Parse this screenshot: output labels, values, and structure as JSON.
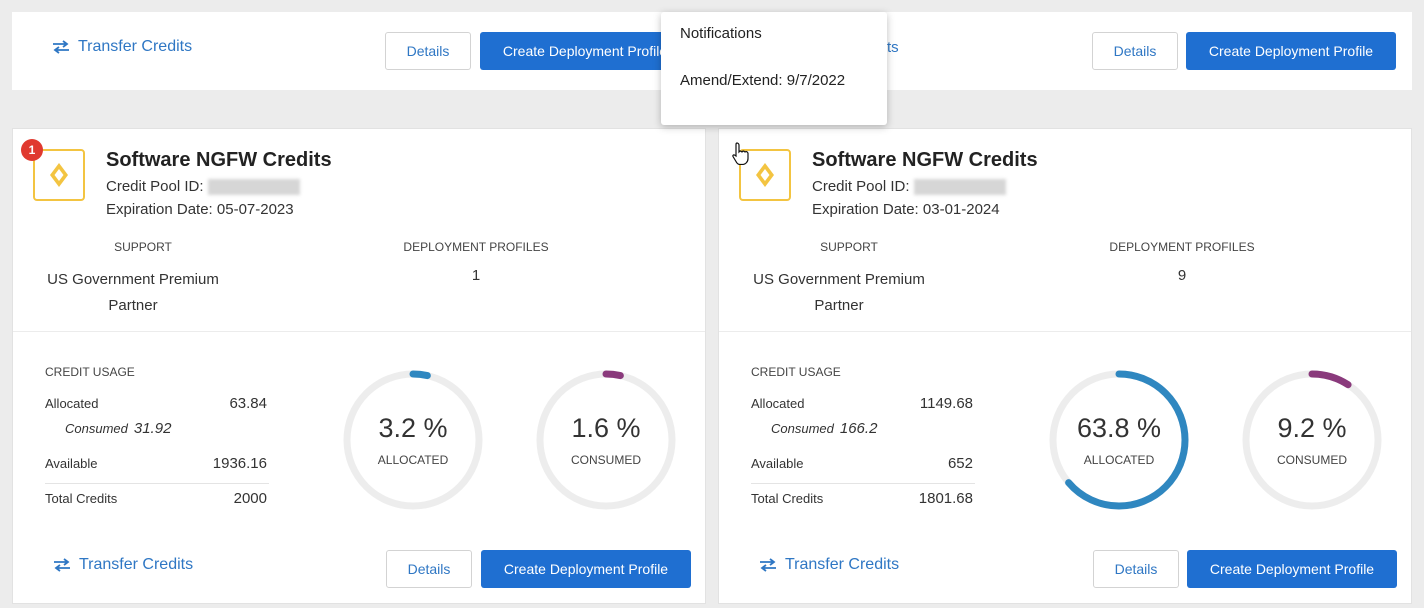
{
  "top_cards": {
    "transfer_label": "Transfer Credits",
    "details_label": "Details",
    "create_label": "Create Deployment Profile",
    "right_fragment": "ts"
  },
  "notifications": {
    "title": "Notifications",
    "item": "Amend/Extend: 9/7/2022"
  },
  "labels": {
    "credit_pool_id": "Credit Pool ID:",
    "support": "SUPPORT",
    "deployment_profiles": "DEPLOYMENT PROFILES",
    "credit_usage": "CREDIT USAGE",
    "allocated": "Allocated",
    "consumed": "Consumed",
    "available": "Available",
    "total_credits": "Total Credits",
    "gauge_allocated": "ALLOCATED",
    "gauge_consumed": "CONSUMED",
    "transfer": "Transfer Credits",
    "details": "Details",
    "create": "Create Deployment Profile"
  },
  "cards": [
    {
      "badge": "1",
      "title": "Software NGFW Credits",
      "expiration": "Expiration Date: 05-07-2023",
      "support_line1": "US Government Premium",
      "support_line2": "Partner",
      "deployment_profiles": "1",
      "allocated": "63.84",
      "consumed": "31.92",
      "available": "1936.16",
      "total": "2000",
      "allocated_pct": "3.2 %",
      "consumed_pct": "1.6 %",
      "allocated_fraction": 0.032,
      "consumed_fraction": 0.016
    },
    {
      "badge": "",
      "title": "Software NGFW Credits",
      "expiration": "Expiration Date: 03-01-2024",
      "support_line1": "US Government Premium",
      "support_line2": "Partner",
      "deployment_profiles": "9",
      "allocated": "1149.68",
      "consumed": "166.2",
      "available": "652",
      "total": "1801.68",
      "allocated_pct": "63.8 %",
      "consumed_pct": "9.2 %",
      "allocated_fraction": 0.638,
      "consumed_fraction": 0.092
    }
  ],
  "colors": {
    "accent_blue": "#1f6fd1",
    "link_blue": "#2f77c4",
    "allocated_ring": "#2f87c0",
    "consumed_ring": "#8a3a7c",
    "logo_yellow": "#f3c441",
    "badge_red": "#e0392f"
  },
  "icons": [
    "transfer-arrows-icon",
    "ngfw-logo-icon",
    "hand-pointer-cursor-icon"
  ]
}
